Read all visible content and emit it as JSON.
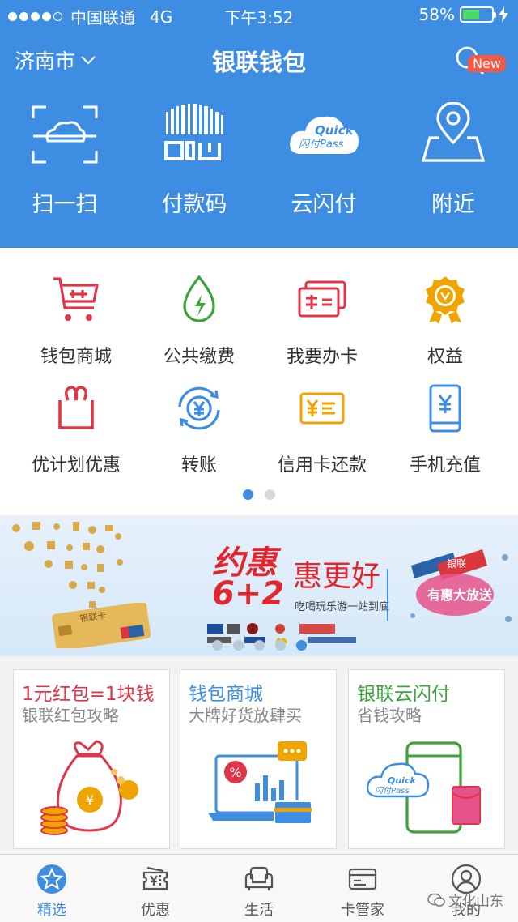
{
  "status_bar": {
    "carrier": "中国联通",
    "network": "4G",
    "time": "下午3:52",
    "battery": "58%",
    "battery_level": 0.58
  },
  "header": {
    "city": "济南市",
    "title": "银联钱包",
    "new_badge": "New",
    "quick_actions": [
      {
        "label": "扫一扫",
        "icon": "scan-icon"
      },
      {
        "label": "付款码",
        "icon": "payment-code-icon"
      },
      {
        "label": "云闪付",
        "icon": "quickpass-icon"
      },
      {
        "label": "附近",
        "icon": "nearby-icon"
      }
    ],
    "quickpass_logo": {
      "line1": "Quick",
      "line2": "闪付Pass"
    }
  },
  "services": {
    "row1": [
      {
        "label": "钱包商城",
        "icon": "cart-icon"
      },
      {
        "label": "公共缴费",
        "icon": "utility-drop-icon"
      },
      {
        "label": "我要办卡",
        "icon": "apply-card-icon"
      },
      {
        "label": "权益",
        "icon": "medal-icon"
      }
    ],
    "row2": [
      {
        "label": "优计划优惠",
        "icon": "gift-icon"
      },
      {
        "label": "转账",
        "icon": "transfer-icon"
      },
      {
        "label": "信用卡还款",
        "icon": "credit-card-repay-icon"
      },
      {
        "label": "手机充值",
        "icon": "phone-recharge-icon"
      }
    ],
    "pager": {
      "pages": 2,
      "active": 0
    }
  },
  "banner": {
    "headline_1": "约惠",
    "headline_2": "6+2",
    "headline_3": "惠更好",
    "slogan": "吃喝玩乐游一站到底",
    "card_label": "银联卡",
    "side_tag": "银联",
    "side_text": "有惠大放送",
    "pager": {
      "pages": 5,
      "active": 4
    }
  },
  "promo_cards": [
    {
      "title": "1元红包=1块钱",
      "subtitle": "银联红包攻略",
      "color": "#e0364a",
      "icon": "money-bag-icon"
    },
    {
      "title": "钱包商城",
      "subtitle": "大牌好货放肆买",
      "color": "#3d8ee3",
      "icon": "shopping-screen-icon"
    },
    {
      "title": "银联云闪付",
      "subtitle": "省钱攻略",
      "color": "#3aa33a",
      "icon": "phone-quickpass-icon"
    }
  ],
  "tabbar": [
    {
      "label": "精选",
      "icon": "star-icon",
      "active": true
    },
    {
      "label": "优惠",
      "icon": "coupon-icon",
      "active": false
    },
    {
      "label": "生活",
      "icon": "sofa-icon",
      "active": false
    },
    {
      "label": "卡管家",
      "icon": "card-manager-icon",
      "active": false
    },
    {
      "label": "我的",
      "icon": "profile-icon",
      "active": false
    }
  ],
  "watermark": "文化山东",
  "colors": {
    "primary": "#3d8ee3",
    "red": "#e0364a",
    "green": "#3aa33a",
    "orange": "#f0a400"
  }
}
